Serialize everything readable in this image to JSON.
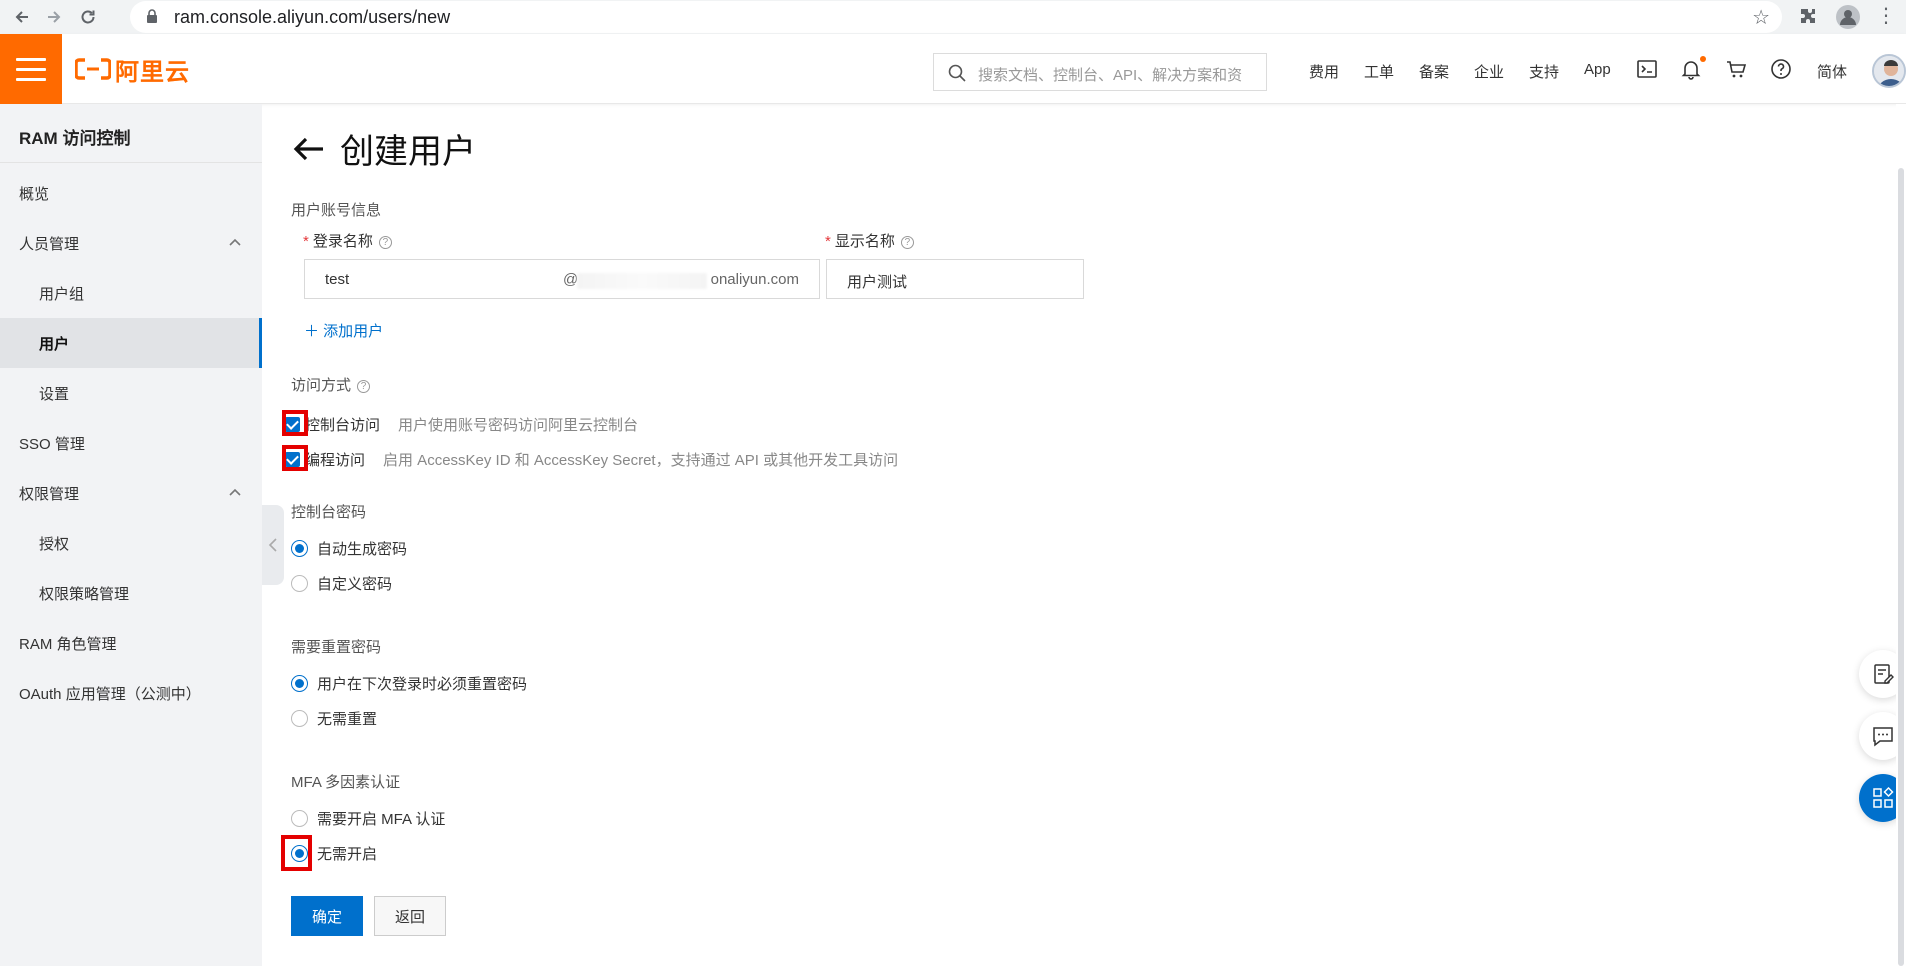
{
  "browser": {
    "url": "ram.console.aliyun.com/users/new"
  },
  "header": {
    "logo_text": "阿里云",
    "search_placeholder": "搜索文档、控制台、API、解决方案和资",
    "nav": [
      "费用",
      "工单",
      "备案",
      "企业",
      "支持",
      "App"
    ],
    "lang": "简体",
    "accent": "#ff6a00"
  },
  "sidebar": {
    "title": "RAM 访问控制",
    "items": [
      {
        "label": "概览",
        "level": "top"
      },
      {
        "label": "人员管理",
        "level": "top",
        "expanded": true
      },
      {
        "label": "用户组",
        "level": "sub"
      },
      {
        "label": "用户",
        "level": "sub",
        "active": true
      },
      {
        "label": "设置",
        "level": "sub"
      },
      {
        "label": "SSO 管理",
        "level": "top"
      },
      {
        "label": "权限管理",
        "level": "top",
        "expanded": true
      },
      {
        "label": "授权",
        "level": "sub"
      },
      {
        "label": "权限策略管理",
        "level": "sub"
      },
      {
        "label": "RAM 角色管理",
        "level": "top"
      },
      {
        "label": "OAuth 应用管理（公测中）",
        "level": "top"
      }
    ]
  },
  "main": {
    "title": "创建用户",
    "account_section": "用户账号信息",
    "login_name_label": "登录名称",
    "login_name_value": "test",
    "login_domain_prefix": "@",
    "login_domain_suffix": "onaliyun.com",
    "display_name_label": "显示名称",
    "display_name_value": "用户测试",
    "add_user": "添加用户",
    "access_section": "访问方式",
    "access_options": [
      {
        "label": "控制台访问",
        "desc": "用户使用账号密码访问阿里云控制台",
        "checked": true
      },
      {
        "label": "编程访问",
        "desc": "启用 AccessKey ID 和 AccessKey Secret，支持通过 API 或其他开发工具访问",
        "checked": true
      }
    ],
    "console_pw_section": "控制台密码",
    "console_pw_options": [
      {
        "label": "自动生成密码",
        "selected": true
      },
      {
        "label": "自定义密码",
        "selected": false
      }
    ],
    "reset_section": "需要重置密码",
    "reset_options": [
      {
        "label": "用户在下次登录时必须重置密码",
        "selected": true
      },
      {
        "label": "无需重置",
        "selected": false
      }
    ],
    "mfa_section": "MFA 多因素认证",
    "mfa_options": [
      {
        "label": "需要开启 MFA 认证",
        "selected": false
      },
      {
        "label": "无需开启",
        "selected": true
      }
    ],
    "confirm_label": "确定",
    "back_label": "返回",
    "primary_color": "#0070cc"
  }
}
